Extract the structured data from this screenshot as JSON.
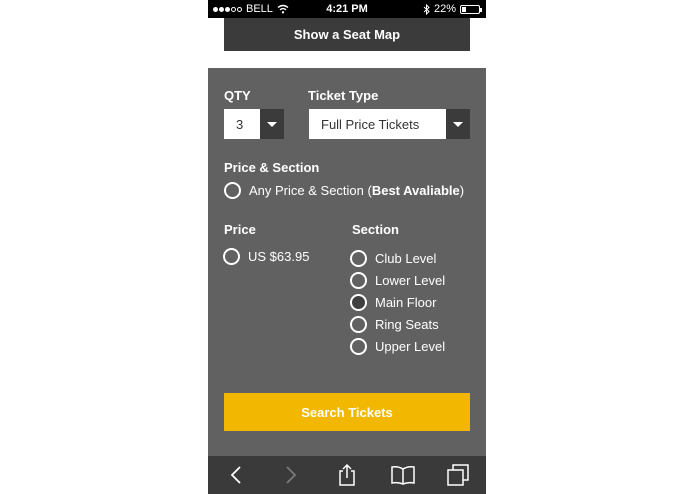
{
  "status_bar": {
    "carrier": "BELL",
    "time": "4:21 PM",
    "battery_percent": "22%",
    "battery_level": 0.22
  },
  "seat_map_button": {
    "label": "Show a Seat Map"
  },
  "qty": {
    "label": "QTY",
    "value": "3"
  },
  "ticket_type": {
    "label": "Ticket Type",
    "value": "Full Price Tickets"
  },
  "price_section": {
    "label": "Price & Section",
    "any_option": {
      "text_start": "Any Price & Section (",
      "bold": "Best Avaliable",
      "text_end": ")"
    }
  },
  "price": {
    "label": "Price",
    "options": [
      "US $63.95"
    ]
  },
  "section": {
    "label": "Section",
    "options": [
      "Club Level",
      "Lower Level",
      "Main Floor",
      "Ring Seats",
      "Upper Level"
    ]
  },
  "search_button": {
    "label": "Search Tickets"
  },
  "toolbar": {
    "icons": [
      "back-icon",
      "forward-icon",
      "share-icon",
      "bookmarks-icon",
      "tabs-icon"
    ]
  }
}
